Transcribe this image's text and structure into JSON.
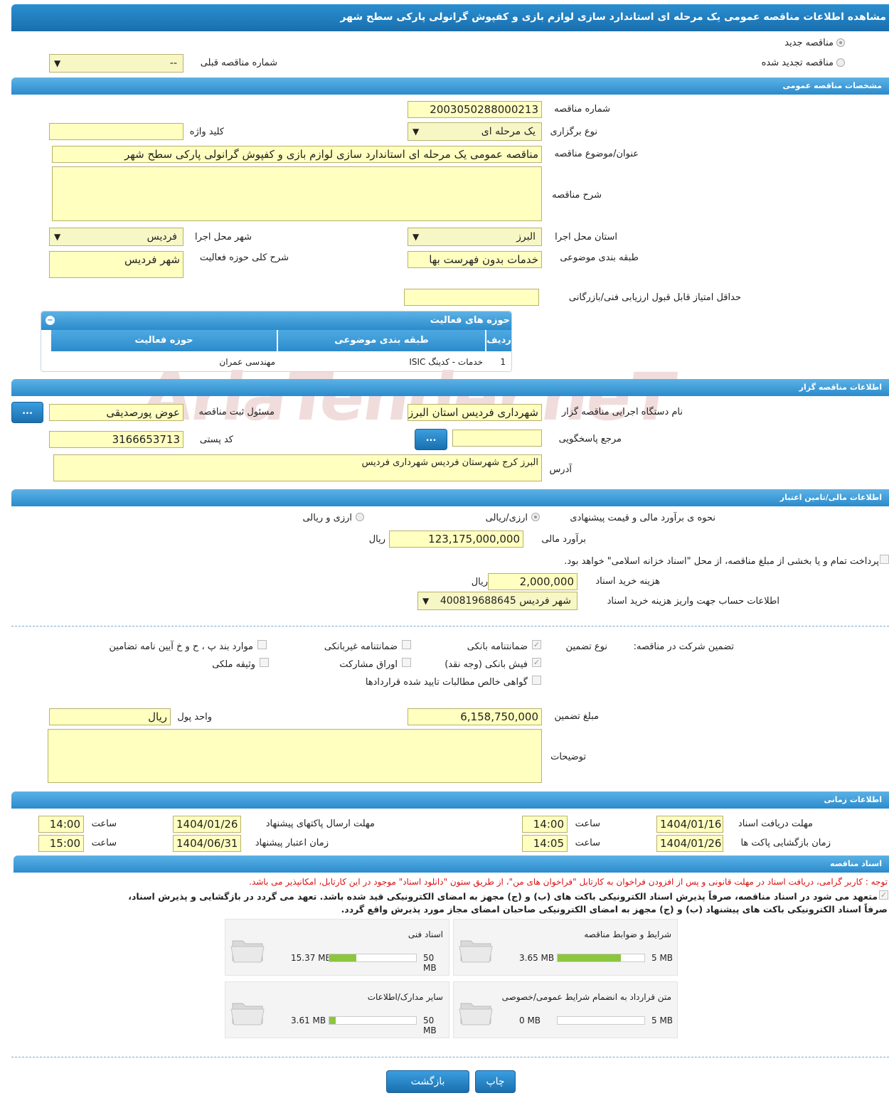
{
  "title": "مشاهده اطلاعات مناقصه عمومی یک مرحله ای استاندارد سازی لوازم بازی و کفپوش گرانولی پارکی سطح شهر",
  "top": {
    "radio_new": "مناقصه جدید",
    "radio_renewed": "مناقصه تجدید شده",
    "prev_tender_label": "شماره مناقصه قبلی",
    "prev_tender_value": "--"
  },
  "general": {
    "header": "مشخصات مناقصه عمومی",
    "number_label": "شماره مناقصه",
    "number_value": "2003050288000213",
    "type_label": "نوع برگزاری",
    "type_value": "یک مرحله ای",
    "keyword_label": "کلید واژه",
    "keyword_value": "",
    "subject_label": "عنوان/موضوع مناقصه",
    "subject_value": "مناقصه عمومی یک مرحله ای استاندارد سازی لوازم بازی و کفپوش گرانولی پارکی سطح شهر",
    "desc_label": "شرح مناقصه",
    "desc_value": "",
    "province_label": "استان محل اجرا",
    "province_value": "البرز",
    "city_label": "شهر محل اجرا",
    "city_value": "فردیس",
    "category_label": "طبقه بندی موضوعی",
    "category_value": "خدمات بدون فهرست بها",
    "scope_label": "شرح کلی حوزه فعالیت",
    "scope_value": "شهر فردیس",
    "min_score_label": "حداقل امتیاز قابل قبول ارزیابی فنی/بازرگانی",
    "min_score_value": ""
  },
  "activity": {
    "header": "حوزه های فعالیت",
    "col_row": "ردیف",
    "col_category": "طبقه بندی موضوعی",
    "col_field": "حوزه فعالیت",
    "rows": [
      {
        "row": "1",
        "category": "خدمات - کدینگ ISIC",
        "field": "مهندسی عمران"
      }
    ]
  },
  "organizer": {
    "header": "اطلاعات مناقصه گزار",
    "org_label": "نام دستگاه اجرایی مناقصه گزار",
    "org_value": "شهرداری فردیس استان البرز",
    "resp_label": "مسئول ثبت مناقصه",
    "resp_value": "عوض پورصدیقی",
    "ref_label": "مرجع پاسخگویی",
    "ref_value": "",
    "postal_label": "کد پستی",
    "postal_value": "3166653713",
    "address_label": "آدرس",
    "address_value": "البرز کرج شهرستان فردیس شهرداری فردیس",
    "more_btn": "..."
  },
  "finance": {
    "header": "اطلاعات مالی/تامین اعتبار",
    "method_label": "نحوه ی برآورد مالی و قیمت پیشنهادی",
    "method_rial": "ارزی/ریالی",
    "method_fx": "ارزی و ریالی",
    "estimate_label": "برآورد مالی",
    "estimate_value": "123,175,000,000",
    "currency": "ریال",
    "treasury_text": "پرداخت تمام و یا بخشی از مبلغ مناقصه، از محل \"اسناد خزانه اسلامی\" خواهد بود.",
    "doc_fee_label": "هزینه خرید اسناد",
    "doc_fee_value": "2,000,000",
    "account_label": "اطلاعات حساب جهت واریز هزینه خرید اسناد",
    "account_value": "شهر فردیس 400819688645"
  },
  "guarantee": {
    "label": "تضمین شرکت در مناقصه:",
    "type_label": "نوع تضمین",
    "bank_guarantee": "ضمانتنامه بانکی",
    "nonbank_guarantee": "ضمانتنامه غیربانکی",
    "other_items": "موارد بند پ ، ح و خ آیین نامه تضامین",
    "bank_receipt": "فیش بانکی (وجه نقد)",
    "bonds": "اوراق مشارکت",
    "property": "وثیقه ملکی",
    "certificate": "گواهی خالص مطالبات تایید شده قراردادها",
    "amount_label": "مبلغ تضمین",
    "amount_value": "6,158,750,000",
    "unit_label": "واحد پول",
    "unit_value": "ریال",
    "notes_label": "توضیحات",
    "notes_value": ""
  },
  "timing": {
    "header": "اطلاعات زمانی",
    "doc_receive_label": "مهلت دریافت اسناد",
    "doc_receive_date": "1404/01/16",
    "doc_receive_time": "14:00",
    "submit_label": "مهلت ارسال پاکتهای پیشنهاد",
    "submit_date": "1404/01/26",
    "submit_time": "14:00",
    "open_label": "زمان بازگشایی پاکت ها",
    "open_date": "1404/01/26",
    "open_time": "14:05",
    "validity_label": "زمان اعتبار پیشنهاد",
    "validity_date": "1404/06/31",
    "validity_time": "15:00",
    "time_label": "ساعت"
  },
  "docs": {
    "header": "اسناد مناقصه",
    "notice": "توجه : کاربر گرامی، دریافت اسناد در مهلت قانونی و پس از افزودن فراخوان به کارتابل \"فراخوان های من\"، از طریق ستون \"دانلود اسناد\" موجود در این کارتابل، امکانپذیر می باشد.",
    "commit_line1": "متعهد می شود در اسناد مناقصه، صرفاً پذیرش اسناد الکترونیکی باکت های (ب) و (ج) مجهز به امضای الکترونیکی قید شده باشد. تعهد می گردد در بازگشایی و پذیرش اسناد،",
    "commit_line2": "صرفاً اسناد الکترونیکی باکت های پیشنهاد (ب) و (ج) مجهز به امضای الکترونیکی صاحبان امضای مجاز مورد پذیرش واقع گردد.",
    "files": [
      {
        "name": "شرایط و ضوابط مناقصه",
        "used": "3.65 MB",
        "max": "5 MB",
        "ratio": 0.73
      },
      {
        "name": "اسناد فنی",
        "used": "15.37 MB",
        "max": "50 MB",
        "ratio": 0.31
      },
      {
        "name": "متن قرارداد به انضمام شرایط عمومی/خصوصی",
        "used": "0 MB",
        "max": "5 MB",
        "ratio": 0.0
      },
      {
        "name": "سایر مدارک/اطلاعات",
        "used": "3.61 MB",
        "max": "50 MB",
        "ratio": 0.07
      }
    ]
  },
  "actions": {
    "print": "چاپ",
    "back": "بازگشت"
  },
  "watermark": "AriaTender.neT"
}
